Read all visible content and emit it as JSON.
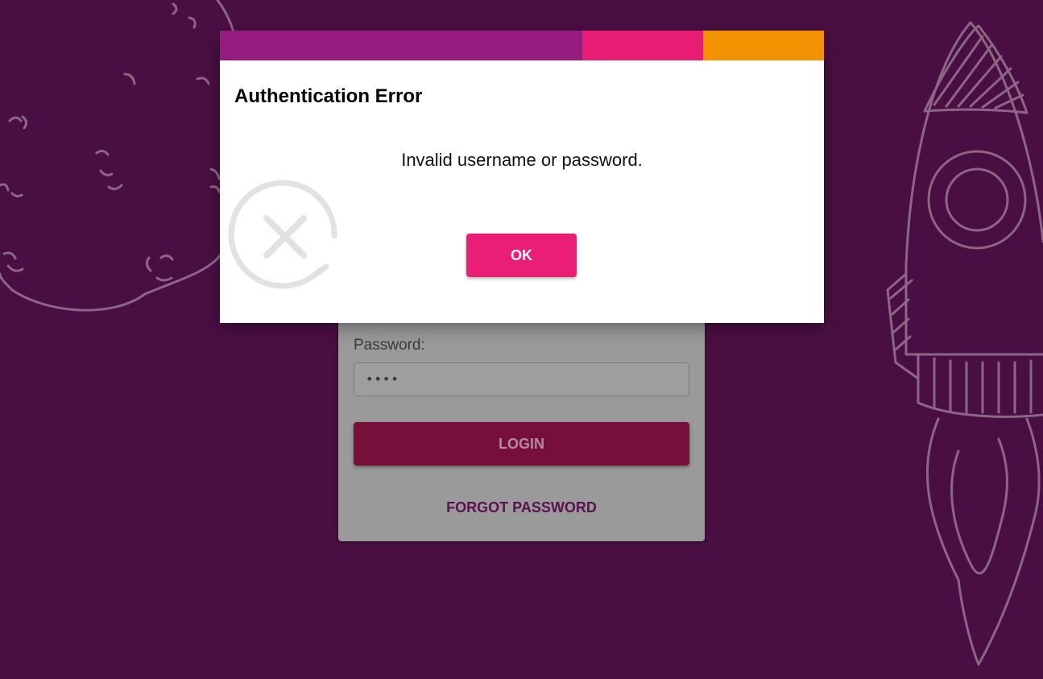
{
  "colors": {
    "background": "#4a0f42",
    "bar_purple": "#951c7e",
    "bar_pink": "#e81e74",
    "bar_orange": "#f39200",
    "ok_button": "#e91e74",
    "login_button": "#76103b"
  },
  "login_form": {
    "password_label": "Password:",
    "password_value": "••••",
    "login_label": "LOGIN",
    "forgot_label": "FORGOT PASSWORD"
  },
  "dialog": {
    "title": "Authentication Error",
    "message": "Invalid username or password.",
    "ok_label": "OK",
    "icon": "error-x-icon"
  },
  "background_art": {
    "left": "moon-doodle-icon",
    "right": "rocket-doodle-icon"
  }
}
